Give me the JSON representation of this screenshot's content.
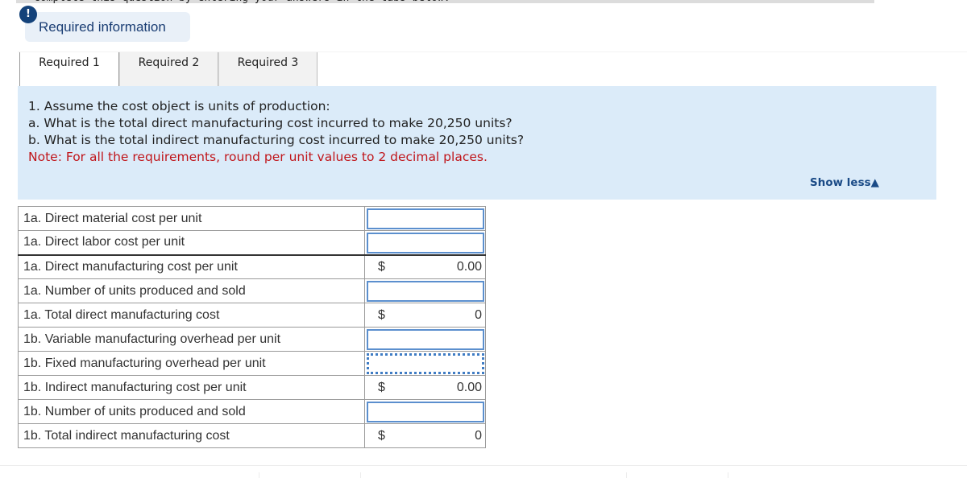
{
  "header": {
    "truncated_instruction": "Complete this question by entering your answers in the tabs below.",
    "required_info_label": "Required information",
    "alert_icon": "exclamation-icon"
  },
  "tabs": [
    {
      "label": "Required 1",
      "active": true
    },
    {
      "label": "Required 2",
      "active": false
    },
    {
      "label": "Required 3",
      "active": false
    }
  ],
  "question": {
    "line1": "1. Assume the cost object is units of production:",
    "line2": "a. What is the total direct manufacturing cost incurred to make 20,250 units?",
    "line3": "b. What is the total indirect manufacturing cost incurred to make 20,250 units?",
    "note": "Note: For all the requirements, round per unit values to 2 decimal places.",
    "show_less_label": "Show less",
    "show_less_icon": "triangle-up-icon"
  },
  "colors": {
    "accent_blue": "#1a4a86",
    "note_red": "#c0161b",
    "panel_bg": "#dbebf9"
  },
  "rows": [
    {
      "label": "1a. Direct material cost per unit",
      "type": "input",
      "value": ""
    },
    {
      "label": "1a. Direct labor cost per unit",
      "type": "input",
      "value": ""
    },
    {
      "label": "1a. Direct manufacturing cost per unit",
      "type": "computed",
      "currency": "$",
      "value": "0.00"
    },
    {
      "label": "1a. Number of units produced and sold",
      "type": "input",
      "value": ""
    },
    {
      "label": "1a. Total direct manufacturing cost",
      "type": "computed",
      "currency": "$",
      "value": "0"
    },
    {
      "label": "1b. Variable manufacturing overhead per unit",
      "type": "input",
      "value": ""
    },
    {
      "label": "1b. Fixed manufacturing overhead per unit",
      "type": "input-focused",
      "value": ""
    },
    {
      "label": "1b. Indirect manufacturing cost per unit",
      "type": "computed",
      "currency": "$",
      "value": "0.00"
    },
    {
      "label": "1b. Number of units produced and sold",
      "type": "input",
      "value": ""
    },
    {
      "label": "1b. Total indirect manufacturing cost",
      "type": "computed",
      "currency": "$",
      "value": "0"
    }
  ]
}
